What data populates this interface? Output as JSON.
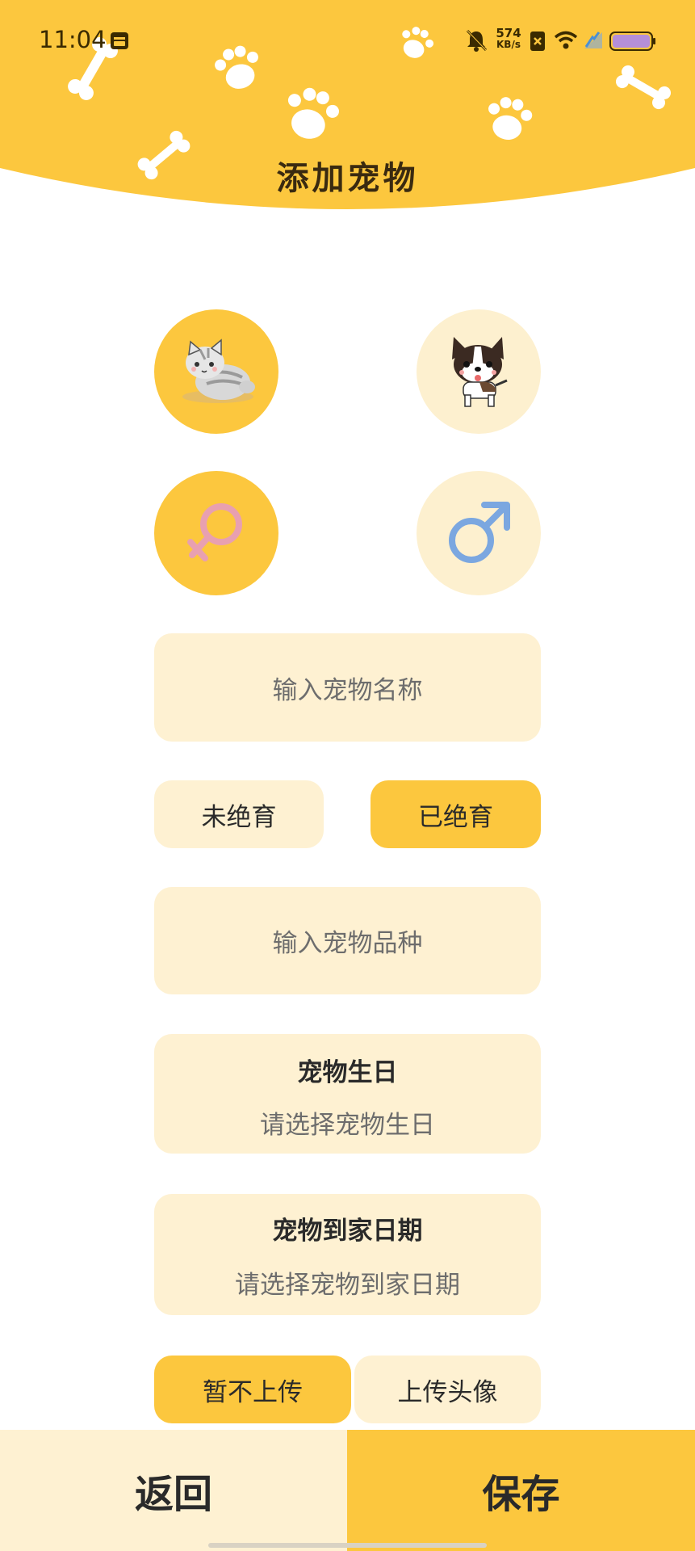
{
  "status_bar": {
    "time": "11:04",
    "net_speed_value": "574",
    "net_speed_unit": "KB/s",
    "icons": [
      "calendar-icon",
      "mute-bell-icon",
      "sim-x-icon",
      "wifi-icon",
      "signal-icon",
      "battery-icon"
    ]
  },
  "header": {
    "title": "添加宠物",
    "background_color": "#FCC73E",
    "decorations": [
      "bone-icon",
      "paw-icon"
    ]
  },
  "pet_type": {
    "options": [
      {
        "id": "cat",
        "icon": "cat-icon",
        "selected": true
      },
      {
        "id": "dog",
        "icon": "dog-icon",
        "selected": false
      }
    ]
  },
  "gender": {
    "options": [
      {
        "id": "female",
        "icon": "female-symbol-icon",
        "color": "#E8A0B0",
        "selected": true
      },
      {
        "id": "male",
        "icon": "male-symbol-icon",
        "color": "#7BA7E0",
        "selected": false
      }
    ]
  },
  "form": {
    "name_placeholder": "输入宠物名称",
    "neuter": {
      "not_neutered": "未绝育",
      "neutered": "已绝育",
      "selected": "neutered"
    },
    "breed_placeholder": "输入宠物品种",
    "birthday": {
      "label": "宠物生日",
      "placeholder": "请选择宠物生日"
    },
    "arrival_date": {
      "label": "宠物到家日期",
      "placeholder": "请选择宠物到家日期"
    },
    "avatar": {
      "skip": "暂不上传",
      "upload": "上传头像",
      "selected": "skip"
    }
  },
  "bottom_bar": {
    "back": "返回",
    "save": "保存"
  },
  "colors": {
    "accent": "#FCC73E",
    "light": "#FEF1D2"
  }
}
